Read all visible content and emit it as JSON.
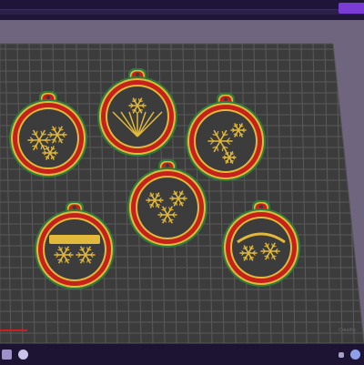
{
  "window": {
    "active_tab_color": "#7b3cd6",
    "chrome_color": "#1f1538"
  },
  "bed": {
    "grid_color": "#5a5a5a",
    "surface_color": "#3c3c3c",
    "watermark": "Creality"
  },
  "ornaments": [
    {
      "id": "ornament-1",
      "pattern": "snowflake-cluster"
    },
    {
      "id": "ornament-2",
      "pattern": "fir-branches"
    },
    {
      "id": "ornament-3",
      "pattern": "snowflake-spray"
    },
    {
      "id": "ornament-4",
      "pattern": "snowflake-banner"
    },
    {
      "id": "ornament-5",
      "pattern": "hanging-snowflakes"
    },
    {
      "id": "ornament-6",
      "pattern": "snowflake-arc"
    }
  ],
  "colors": {
    "rim": "#2e7d3a",
    "body": "#c4221a",
    "filigree": "#e2b93a"
  },
  "toolbar": {
    "left_icons": [
      "layers-icon",
      "home-icon"
    ],
    "right_icons": [
      "view-icon",
      "settings-icon"
    ]
  }
}
